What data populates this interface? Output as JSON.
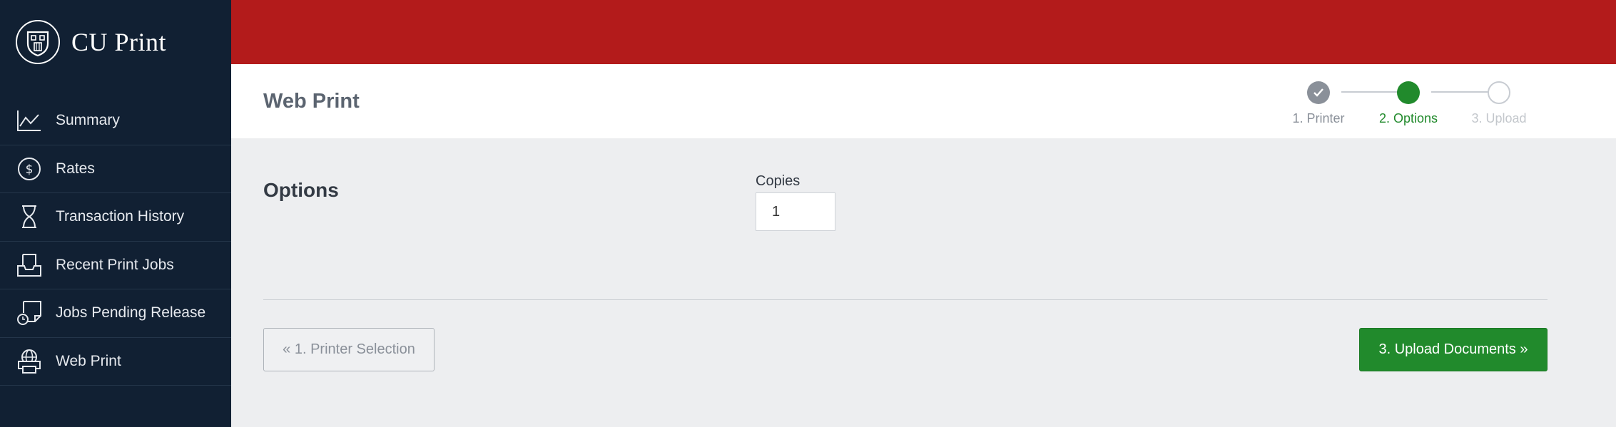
{
  "brand": {
    "name": "CU Print"
  },
  "sidebar": {
    "items": [
      {
        "label": "Summary",
        "icon": "chart-line-icon"
      },
      {
        "label": "Rates",
        "icon": "dollar-circle-icon"
      },
      {
        "label": "Transaction History",
        "icon": "hourglass-icon"
      },
      {
        "label": "Recent Print Jobs",
        "icon": "tray-icon"
      },
      {
        "label": "Jobs Pending Release",
        "icon": "document-clock-icon"
      },
      {
        "label": "Web Print",
        "icon": "web-print-icon"
      }
    ]
  },
  "header": {
    "title": "Web Print",
    "steps": [
      {
        "label": "1. Printer",
        "state": "complete"
      },
      {
        "label": "2. Options",
        "state": "active"
      },
      {
        "label": "3. Upload",
        "state": "pending"
      }
    ]
  },
  "options": {
    "section_title": "Options",
    "copies_label": "Copies",
    "copies_value": "1"
  },
  "buttons": {
    "back_label": "« 1. Printer Selection",
    "next_label": "3. Upload Documents »"
  },
  "colors": {
    "sidebar": "#112033",
    "topbar": "#b31b1b",
    "active_step": "#218a2c",
    "complete_step": "#8a9099",
    "primary_button": "#218a2c"
  }
}
